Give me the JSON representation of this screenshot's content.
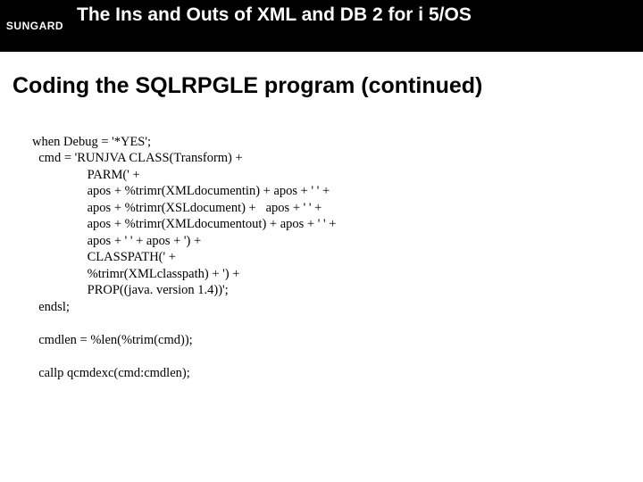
{
  "header": {
    "logo": "SUNGARD",
    "title": "The Ins and Outs of XML and DB 2 for i 5/OS"
  },
  "section": {
    "title": "Coding the SQLRPGLE program (continued)"
  },
  "code": {
    "lines": [
      "when Debug = '*YES';",
      "  cmd = 'RUNJVA CLASS(Transform) +",
      "                 PARM(' +",
      "                 apos + %trimr(XMLdocumentin) + apos + ' ' +",
      "                 apos + %trimr(XSLdocument) +   apos + ' ' +",
      "                 apos + %trimr(XMLdocumentout) + apos + ' ' +",
      "                 apos + ' ' + apos + ') +",
      "                 CLASSPATH(' +",
      "                 %trimr(XMLclasspath) + ') +",
      "                 PROP((java. version 1.4))';",
      "  endsl;",
      "",
      "  cmdlen = %len(%trim(cmd));",
      "",
      "  callp qcmdexc(cmd:cmdlen);"
    ]
  }
}
